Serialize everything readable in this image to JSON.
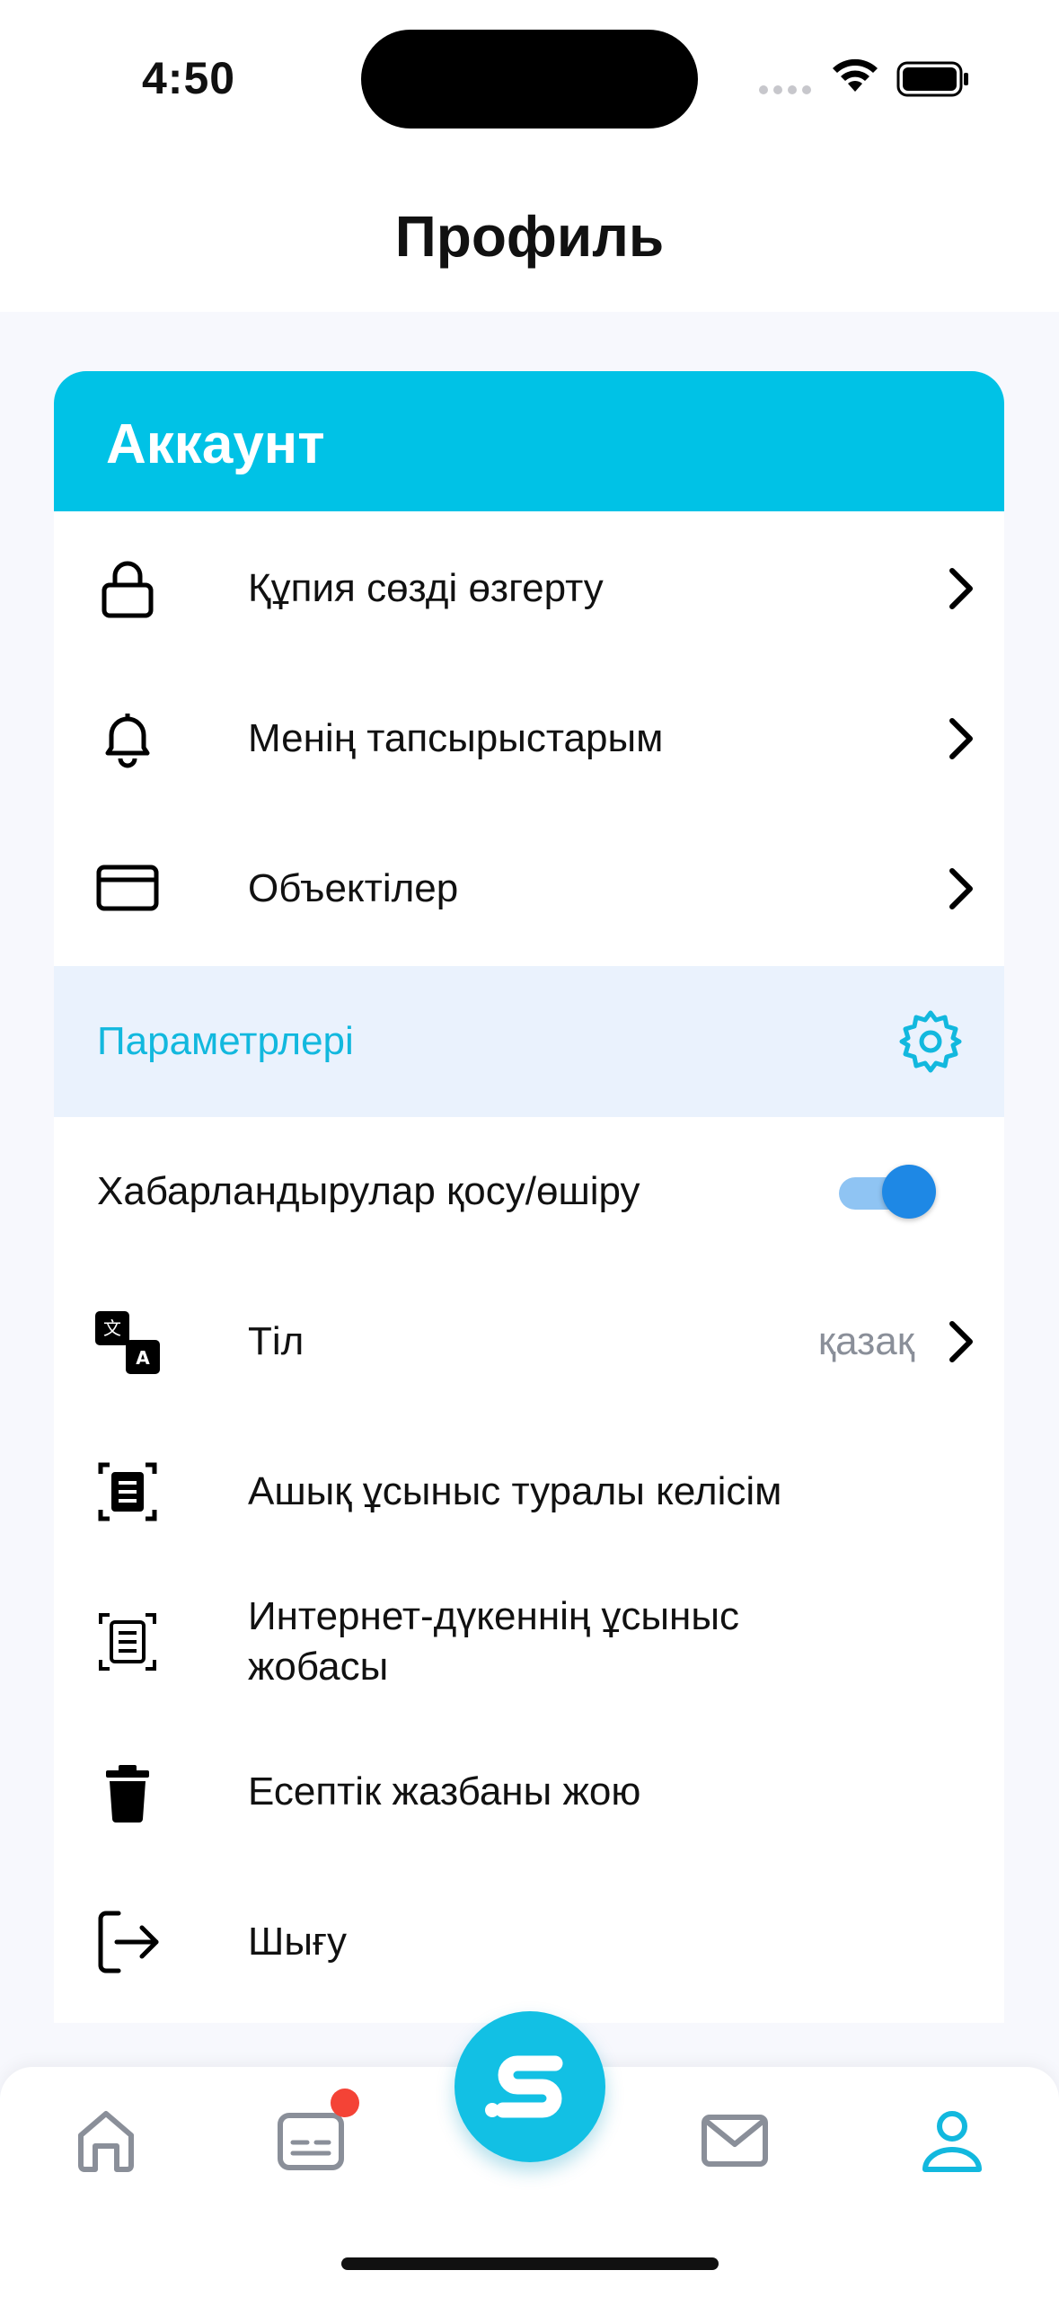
{
  "status": {
    "time": "4:50"
  },
  "header": {
    "title": "Профиль"
  },
  "account": {
    "title": "Аккаунт",
    "items": [
      {
        "label": "Құпия сөзді өзгерту",
        "icon": "lock-icon"
      },
      {
        "label": "Менің тапсырыстарым",
        "icon": "bell-icon"
      },
      {
        "label": "Объектілер",
        "icon": "card-icon"
      }
    ]
  },
  "settings": {
    "title": "Параметрлері",
    "icon": "gear-icon",
    "notifications": {
      "label": "Хабарландырулар қосу/өшіру",
      "enabled": true
    },
    "language": {
      "label": "Тіл",
      "value": "қазақ",
      "icon": "translate-icon"
    },
    "items": [
      {
        "label": "Ашық ұсыныс туралы келісім",
        "icon": "document-icon"
      },
      {
        "label": "Интернет-дүкеннің ұсыныс жобасы",
        "icon": "document-icon"
      },
      {
        "label": "Есептік жазбаны жою",
        "icon": "trash-icon"
      },
      {
        "label": "Шығу",
        "icon": "logout-icon"
      }
    ]
  },
  "colors": {
    "accent": "#00c2e6",
    "section_bg": "#eaf2fd",
    "toggle": "#1e88e5",
    "badge": "#f44336"
  },
  "tabbar": {
    "tabs": [
      {
        "icon": "home-icon",
        "active": false
      },
      {
        "icon": "ticket-icon",
        "active": false,
        "has_badge": true
      },
      {
        "icon": "logo-icon",
        "active": false
      },
      {
        "icon": "mail-icon",
        "active": false
      },
      {
        "icon": "profile-icon",
        "active": true
      }
    ]
  }
}
